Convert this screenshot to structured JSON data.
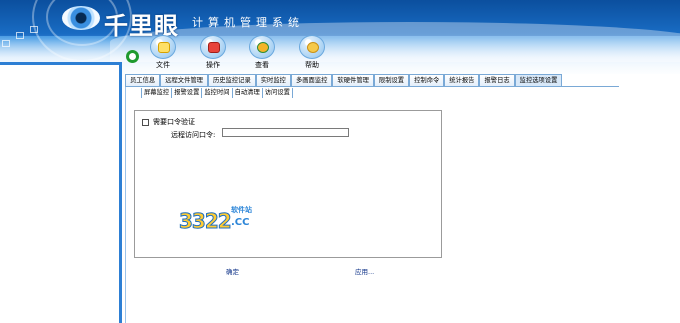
{
  "app": {
    "title": "千里眼",
    "subtitle": "计算机管理系统"
  },
  "toolbar": {
    "items": [
      {
        "label": "文件",
        "icon": "file-icon"
      },
      {
        "label": "操作",
        "icon": "operate-icon"
      },
      {
        "label": "查看",
        "icon": "view-icon"
      },
      {
        "label": "帮助",
        "icon": "help-icon"
      }
    ]
  },
  "tabs": [
    "员工信息",
    "远程文件管理",
    "历史监控记录",
    "实时监控",
    "多画面监控",
    "软硬件管理",
    "限制设置",
    "控制命令",
    "统计报告",
    "报警日志",
    "监控选项设置"
  ],
  "active_tab": "监控选项设置",
  "subtabs": [
    "屏幕监控",
    "报警设置",
    "监控时间",
    "自动清理",
    "访问设置"
  ],
  "form": {
    "require_password_label": "需要口令验证",
    "require_password_checked": false,
    "remote_password_label": "远程访问口令:",
    "remote_password_value": ""
  },
  "buttons": {
    "ok": "确定",
    "apply": "应用..."
  },
  "watermark": {
    "number": "3322",
    "suffix": ".CC",
    "tag": "软件站"
  },
  "colors": {
    "header_blue": "#1570c8",
    "accent_green": "#1f9a2e",
    "border_blue": "#2d7fd4"
  }
}
